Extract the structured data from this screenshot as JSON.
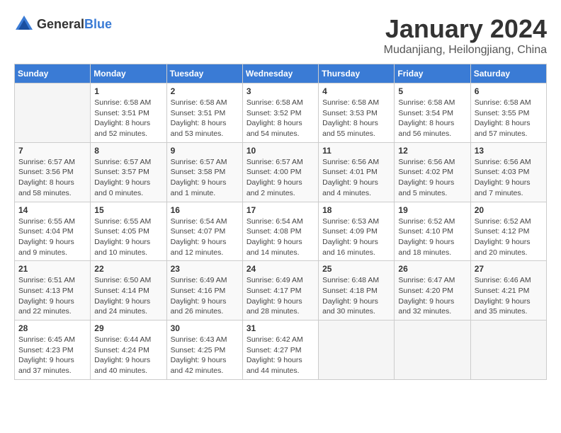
{
  "header": {
    "logo_general": "General",
    "logo_blue": "Blue",
    "month": "January 2024",
    "location": "Mudanjiang, Heilongjiang, China"
  },
  "days_of_week": [
    "Sunday",
    "Monday",
    "Tuesday",
    "Wednesday",
    "Thursday",
    "Friday",
    "Saturday"
  ],
  "weeks": [
    [
      {
        "day": "",
        "info": ""
      },
      {
        "day": "1",
        "info": "Sunrise: 6:58 AM\nSunset: 3:51 PM\nDaylight: 8 hours\nand 52 minutes."
      },
      {
        "day": "2",
        "info": "Sunrise: 6:58 AM\nSunset: 3:51 PM\nDaylight: 8 hours\nand 53 minutes."
      },
      {
        "day": "3",
        "info": "Sunrise: 6:58 AM\nSunset: 3:52 PM\nDaylight: 8 hours\nand 54 minutes."
      },
      {
        "day": "4",
        "info": "Sunrise: 6:58 AM\nSunset: 3:53 PM\nDaylight: 8 hours\nand 55 minutes."
      },
      {
        "day": "5",
        "info": "Sunrise: 6:58 AM\nSunset: 3:54 PM\nDaylight: 8 hours\nand 56 minutes."
      },
      {
        "day": "6",
        "info": "Sunrise: 6:58 AM\nSunset: 3:55 PM\nDaylight: 8 hours\nand 57 minutes."
      }
    ],
    [
      {
        "day": "7",
        "info": "Sunrise: 6:57 AM\nSunset: 3:56 PM\nDaylight: 8 hours\nand 58 minutes."
      },
      {
        "day": "8",
        "info": "Sunrise: 6:57 AM\nSunset: 3:57 PM\nDaylight: 9 hours\nand 0 minutes."
      },
      {
        "day": "9",
        "info": "Sunrise: 6:57 AM\nSunset: 3:58 PM\nDaylight: 9 hours\nand 1 minute."
      },
      {
        "day": "10",
        "info": "Sunrise: 6:57 AM\nSunset: 4:00 PM\nDaylight: 9 hours\nand 2 minutes."
      },
      {
        "day": "11",
        "info": "Sunrise: 6:56 AM\nSunset: 4:01 PM\nDaylight: 9 hours\nand 4 minutes."
      },
      {
        "day": "12",
        "info": "Sunrise: 6:56 AM\nSunset: 4:02 PM\nDaylight: 9 hours\nand 5 minutes."
      },
      {
        "day": "13",
        "info": "Sunrise: 6:56 AM\nSunset: 4:03 PM\nDaylight: 9 hours\nand 7 minutes."
      }
    ],
    [
      {
        "day": "14",
        "info": "Sunrise: 6:55 AM\nSunset: 4:04 PM\nDaylight: 9 hours\nand 9 minutes."
      },
      {
        "day": "15",
        "info": "Sunrise: 6:55 AM\nSunset: 4:05 PM\nDaylight: 9 hours\nand 10 minutes."
      },
      {
        "day": "16",
        "info": "Sunrise: 6:54 AM\nSunset: 4:07 PM\nDaylight: 9 hours\nand 12 minutes."
      },
      {
        "day": "17",
        "info": "Sunrise: 6:54 AM\nSunset: 4:08 PM\nDaylight: 9 hours\nand 14 minutes."
      },
      {
        "day": "18",
        "info": "Sunrise: 6:53 AM\nSunset: 4:09 PM\nDaylight: 9 hours\nand 16 minutes."
      },
      {
        "day": "19",
        "info": "Sunrise: 6:52 AM\nSunset: 4:10 PM\nDaylight: 9 hours\nand 18 minutes."
      },
      {
        "day": "20",
        "info": "Sunrise: 6:52 AM\nSunset: 4:12 PM\nDaylight: 9 hours\nand 20 minutes."
      }
    ],
    [
      {
        "day": "21",
        "info": "Sunrise: 6:51 AM\nSunset: 4:13 PM\nDaylight: 9 hours\nand 22 minutes."
      },
      {
        "day": "22",
        "info": "Sunrise: 6:50 AM\nSunset: 4:14 PM\nDaylight: 9 hours\nand 24 minutes."
      },
      {
        "day": "23",
        "info": "Sunrise: 6:49 AM\nSunset: 4:16 PM\nDaylight: 9 hours\nand 26 minutes."
      },
      {
        "day": "24",
        "info": "Sunrise: 6:49 AM\nSunset: 4:17 PM\nDaylight: 9 hours\nand 28 minutes."
      },
      {
        "day": "25",
        "info": "Sunrise: 6:48 AM\nSunset: 4:18 PM\nDaylight: 9 hours\nand 30 minutes."
      },
      {
        "day": "26",
        "info": "Sunrise: 6:47 AM\nSunset: 4:20 PM\nDaylight: 9 hours\nand 32 minutes."
      },
      {
        "day": "27",
        "info": "Sunrise: 6:46 AM\nSunset: 4:21 PM\nDaylight: 9 hours\nand 35 minutes."
      }
    ],
    [
      {
        "day": "28",
        "info": "Sunrise: 6:45 AM\nSunset: 4:23 PM\nDaylight: 9 hours\nand 37 minutes."
      },
      {
        "day": "29",
        "info": "Sunrise: 6:44 AM\nSunset: 4:24 PM\nDaylight: 9 hours\nand 40 minutes."
      },
      {
        "day": "30",
        "info": "Sunrise: 6:43 AM\nSunset: 4:25 PM\nDaylight: 9 hours\nand 42 minutes."
      },
      {
        "day": "31",
        "info": "Sunrise: 6:42 AM\nSunset: 4:27 PM\nDaylight: 9 hours\nand 44 minutes."
      },
      {
        "day": "",
        "info": ""
      },
      {
        "day": "",
        "info": ""
      },
      {
        "day": "",
        "info": ""
      }
    ]
  ]
}
